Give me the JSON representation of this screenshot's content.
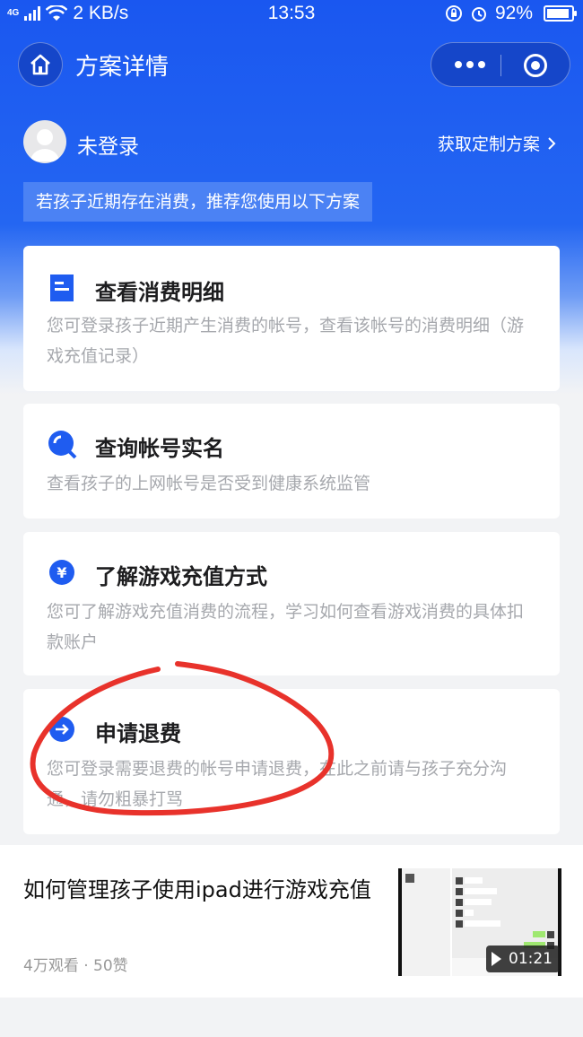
{
  "status_bar": {
    "network": "4G",
    "speed": "2 KB/s",
    "time": "13:53",
    "battery": "92%",
    "battery_level": 0.92
  },
  "nav": {
    "title": "方案详情"
  },
  "user": {
    "name": "未登录",
    "custom_plan_link": "获取定制方案"
  },
  "banner": "若孩子近期存在消费，推荐您使用以下方案",
  "cards": [
    {
      "title": "查看消费明细",
      "desc": "您可登录孩子近期产生消费的帐号，查看该帐号的消费明细（游戏充值记录）",
      "icon": "document-icon"
    },
    {
      "title": "查询帐号实名",
      "desc": "查看孩子的上网帐号是否受到健康系统监管",
      "icon": "search-icon"
    },
    {
      "title": "了解游戏充值方式",
      "desc": "您可了解游戏充值消费的流程，学习如何查看游戏消费的具体扣款账户",
      "icon": "yuan-icon"
    },
    {
      "title": "申请退费",
      "desc": "您可登录需要退费的帐号申请退费，在此之前请与孩子充分沟通，请勿粗暴打骂",
      "icon": "arrow-right-icon"
    }
  ],
  "video": {
    "title": "如何管理孩子使用ipad进行游戏充值",
    "meta": "4万观看 · 50赞",
    "duration": "01:21"
  },
  "colors": {
    "primary_blue": "#1a57f0",
    "annotation_red": "#e8322b"
  }
}
